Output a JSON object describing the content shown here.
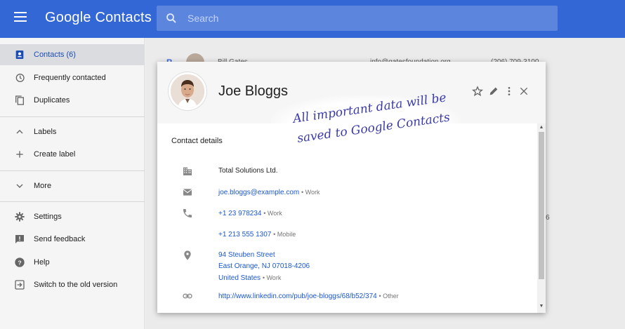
{
  "app": {
    "title": "Google Contacts"
  },
  "search": {
    "placeholder": "Search"
  },
  "sidebar": {
    "items": [
      {
        "label": "Contacts (6)",
        "icon": "contacts-icon"
      },
      {
        "label": "Frequently contacted",
        "icon": "history-icon"
      },
      {
        "label": "Duplicates",
        "icon": "duplicates-icon"
      },
      {
        "label": "Labels",
        "icon": "chevron-up-icon"
      },
      {
        "label": "Create label",
        "icon": "plus-icon"
      },
      {
        "label": "More",
        "icon": "chevron-down-icon"
      },
      {
        "label": "Settings",
        "icon": "gear-icon"
      },
      {
        "label": "Send feedback",
        "icon": "feedback-icon"
      },
      {
        "label": "Help",
        "icon": "help-icon"
      },
      {
        "label": "Switch to the old version",
        "icon": "exit-icon"
      }
    ]
  },
  "background_list": {
    "letter": "B",
    "name": "Bill Gates",
    "email": "info@gatesfoundation.org",
    "phone": "(206) 709-3100",
    "edge_char": "6"
  },
  "card": {
    "name": "Joe Bloggs",
    "section_title": "Contact details",
    "company": "Total Solutions Ltd.",
    "email": {
      "value": "joe.bloggs@example.com",
      "tag": "• Work"
    },
    "phones": [
      {
        "value": "+1 23 978234",
        "tag": "• Work"
      },
      {
        "value": "+1 213 555 1307",
        "tag": "• Mobile"
      }
    ],
    "address": {
      "line1": "94 Steuben Street",
      "line2": "East Orange, NJ 07018-4206",
      "line3": "United States",
      "tag": "• Work"
    },
    "website": {
      "value": "http://www.linkedin.com/pub/joe-bloggs/68/b52/374",
      "tag": "• Other"
    }
  },
  "annotation": {
    "line1": "All important data will be",
    "line2": "saved to Google Contacts"
  },
  "colors": {
    "topbar": "#3367d6",
    "link": "#1a57d1",
    "active_nav": "#1a4cb3"
  }
}
